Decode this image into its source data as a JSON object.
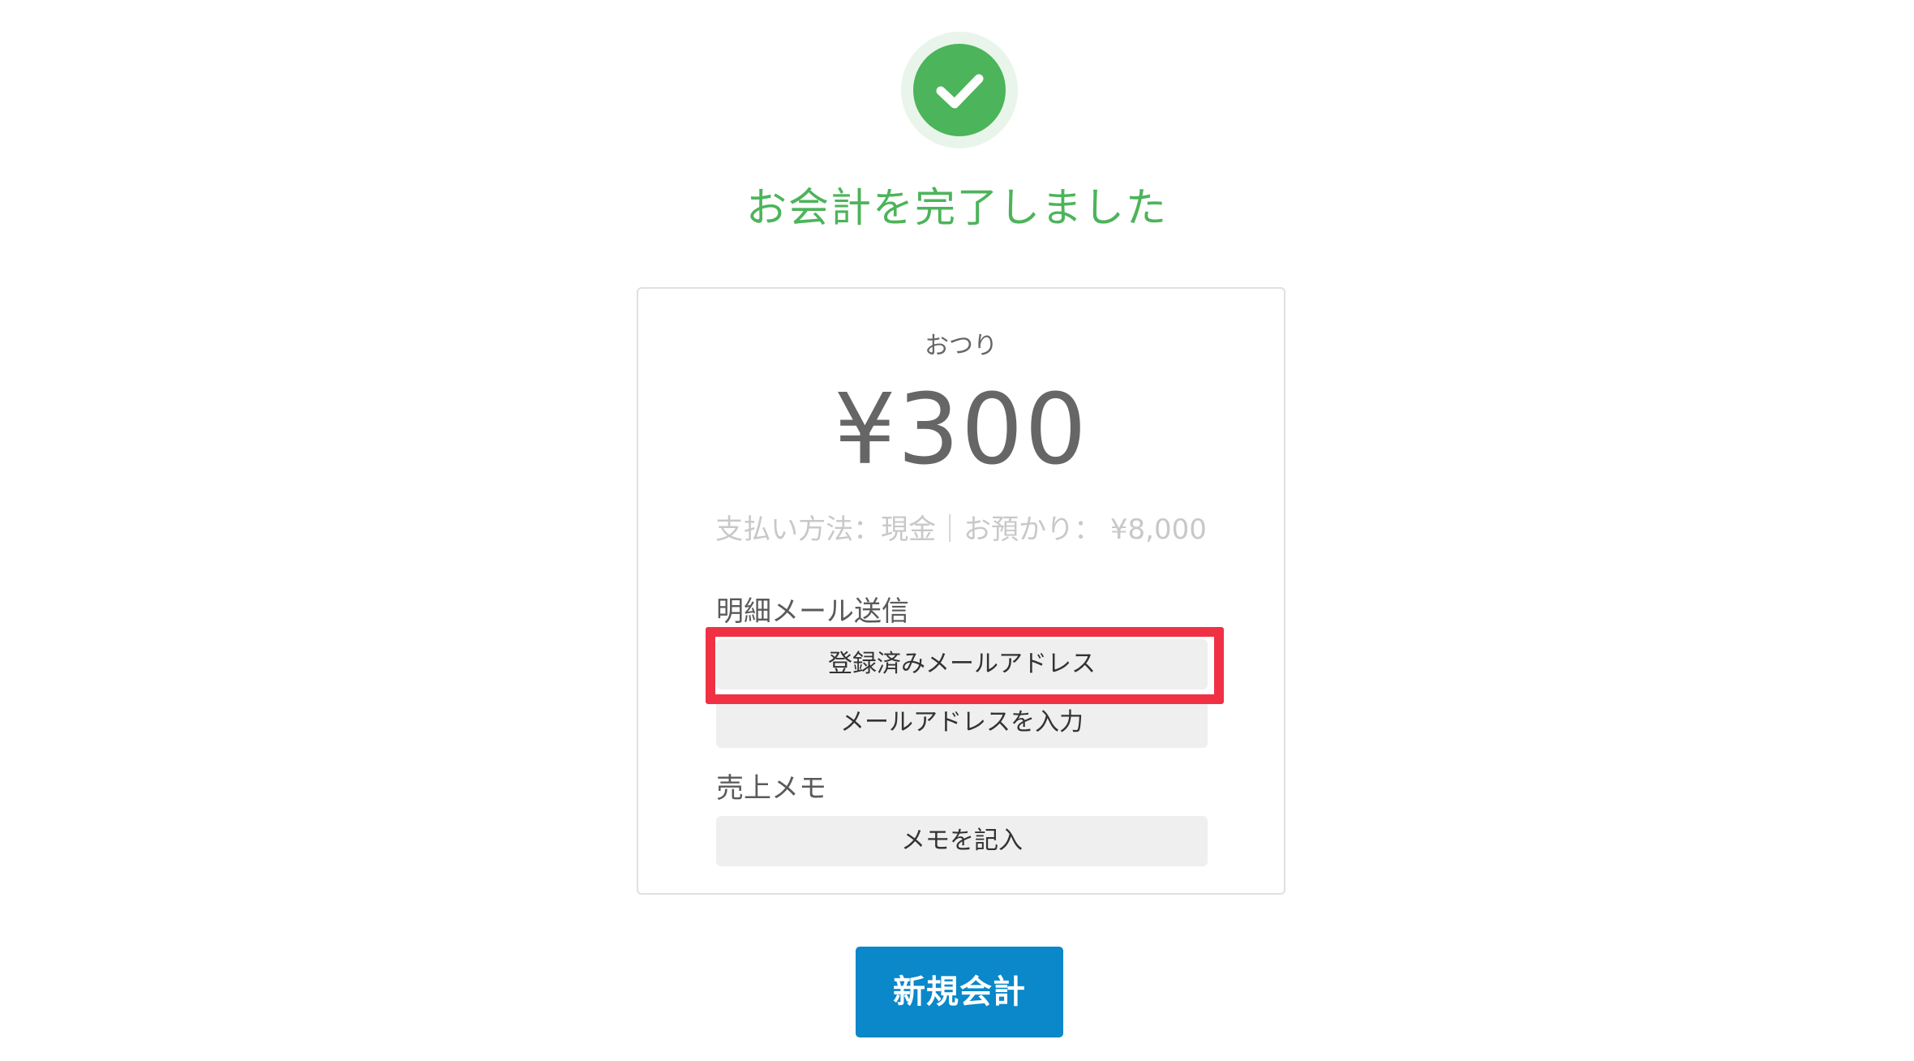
{
  "status": {
    "icon": "check-icon",
    "title": "お会計を完了しました",
    "color": "#4cb45a"
  },
  "receipt": {
    "change_label": "おつり",
    "change_amount": "¥300",
    "payment_info": "支払い方法：現金｜お預かり： ¥8,000"
  },
  "email_section": {
    "label": "明細メール送信",
    "registered_button": "登録済みメールアドレス",
    "enter_button": "メールアドレスを入力"
  },
  "memo_section": {
    "label": "売上メモ",
    "memo_button": "メモを記入"
  },
  "footer": {
    "new_checkout_button": "新規会計",
    "button_color": "#0a88c9"
  },
  "highlight_color": "#f03144"
}
